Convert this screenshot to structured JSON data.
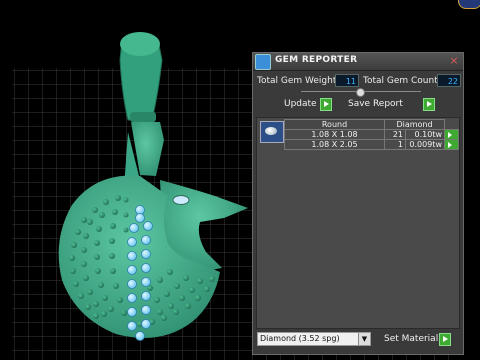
{
  "window": {
    "title": "GEM REPORTER",
    "close_glyph": "×"
  },
  "stats": {
    "total_gem_weight_label": "Total Gem Weight",
    "total_gem_weight_value": "11",
    "total_gem_count_label": "Total Gem Count",
    "total_gem_count_value": "22"
  },
  "actions": {
    "update_label": "Update",
    "save_report_label": "Save Report"
  },
  "table": {
    "headers": [
      "Round",
      "Diamond"
    ],
    "rows": [
      {
        "size": "1.08 X 1.08",
        "count": "21",
        "weight": "0.10tw"
      },
      {
        "size": "1.08 X 2.05",
        "count": "1",
        "weight": "0.009tw"
      }
    ]
  },
  "footer": {
    "material_select": "Diamond    (3.52 spg)",
    "set_material_label": "Set Material"
  },
  "colors": {
    "model": "#3aa786",
    "gem": "#7fd7ff",
    "accent": "#36b6ff",
    "play_button": "#3eaa32"
  }
}
